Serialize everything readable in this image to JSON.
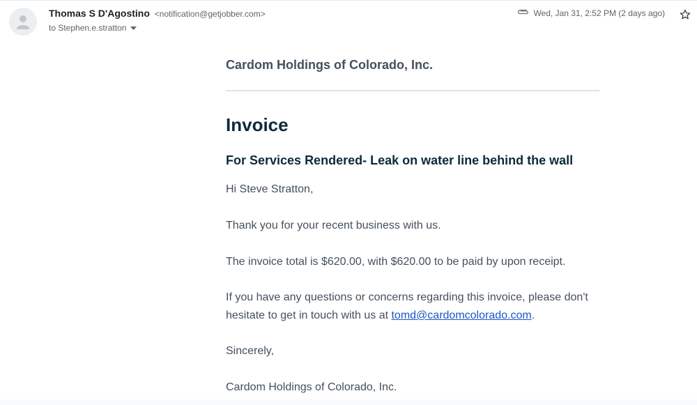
{
  "header": {
    "sender_name": "Thomas S D'Agostino",
    "sender_email": "<notification@getjobber.com>",
    "to_label": "to Stephen.e.stratton",
    "timestamp": "Wed, Jan 31, 2:52 PM (2 days ago)",
    "icons": {
      "avatar": "person-icon",
      "attachment": "paperclip-icon",
      "star": "star-outline-icon",
      "dropdown": "caret-down-icon"
    }
  },
  "body": {
    "company": "Cardom Holdings of Colorado, Inc.",
    "title": "Invoice",
    "services": "For Services Rendered- Leak on water line behind the wall",
    "greeting": "Hi Steve Stratton,",
    "thanks": "Thank you for your recent business with us.",
    "total": "The invoice total is $620.00, with $620.00 to be paid by upon receipt.",
    "questions_prefix": "If you have any questions or concerns regarding this invoice, please don't hesitate to get in touch with us at ",
    "contact_email": "tomd@cardomcolorado.com",
    "questions_suffix": ".",
    "closing": "Sincerely,",
    "signoff": "Cardom Holdings of Colorado, Inc."
  },
  "colors": {
    "link": "#1a55c5",
    "heading": "#0d2a3a",
    "body_text": "#44505c"
  }
}
